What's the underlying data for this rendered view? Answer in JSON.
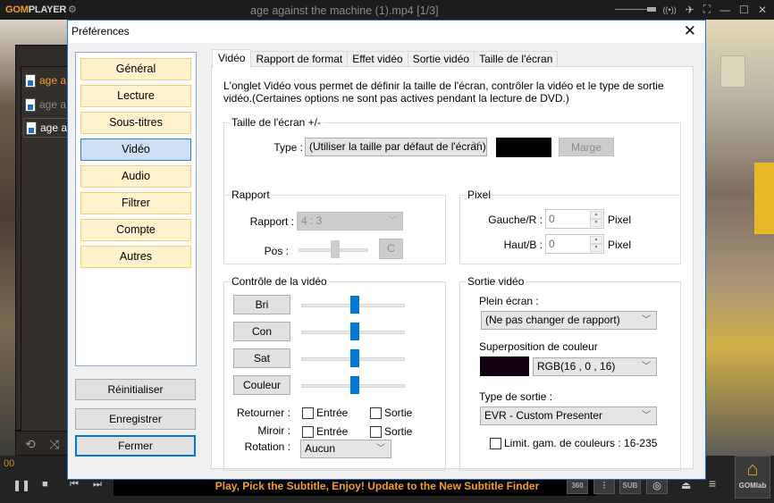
{
  "player": {
    "logo_gom": "GOM",
    "logo_player": "PLAYER",
    "title": "age against the machine (1).mp4  [1/3]",
    "playlist": [
      {
        "label": "age a",
        "state": "playing",
        "color": "#f0a020"
      },
      {
        "label": "age a",
        "state": "normal",
        "color": "#8a8a8a"
      },
      {
        "label": "age a",
        "state": "selected",
        "color": "#ffffff"
      }
    ],
    "timecode": "00",
    "ticker": "Play, Pick the Subtitle, Enjoy! Update to the New Subtitle Finder",
    "buttons": {
      "vr360": "360",
      "sub": "SUB",
      "gomlab": "GOMlab"
    },
    "icons": {
      "gear": "⚙",
      "broadcast": "((•))",
      "pin": "✈",
      "fullscreen": "⛶",
      "minimize": "—",
      "maximize": "☐",
      "close": "✕",
      "repeat": "⟲",
      "shuffle": "⤨",
      "pause": "❚❚",
      "stop": "■",
      "prev": "⏮",
      "next": "⏭",
      "eject": "⏏",
      "menu": "≡",
      "equalizer": "⫶",
      "camera": "◎",
      "home": "⌂"
    }
  },
  "dialog": {
    "title": "Préférences",
    "close_icon": "✕",
    "nav": [
      {
        "label": "Général",
        "active": false
      },
      {
        "label": "Lecture",
        "active": false
      },
      {
        "label": "Sous-titres",
        "active": false
      },
      {
        "label": "Vidéo",
        "active": true
      },
      {
        "label": "Audio",
        "active": false
      },
      {
        "label": "Filtrer",
        "active": false
      },
      {
        "label": "Compte",
        "active": false
      },
      {
        "label": "Autres",
        "active": false
      }
    ],
    "actions": {
      "reset": "Réinitialiser",
      "save": "Enregistrer",
      "close": "Fermer"
    },
    "tabs": [
      {
        "label": "Vidéo",
        "active": true
      },
      {
        "label": "Rapport de format",
        "active": false
      },
      {
        "label": "Effet vidéo",
        "active": false
      },
      {
        "label": "Sortie vidéo",
        "active": false
      },
      {
        "label": "Taille de l'écran",
        "active": false
      }
    ],
    "description": "L'onglet Vidéo vous permet de définir la taille de l'écran, contrôler la vidéo et le type de sortie vidéo.(Certaines options ne sont pas actives pendant la lecture de DVD.)",
    "screen_size": {
      "group_label": "Taille de l'écran +/-",
      "type_label": "Type :",
      "type_value": "(Utiliser la taille par défaut de l'écran)",
      "swatch_color": "#000000",
      "margin_button": "Marge"
    },
    "ratio": {
      "group_label": "Rapport",
      "ratio_label": "Rapport :",
      "ratio_value": "4 : 3",
      "pos_label": "Pos :",
      "pos_value": 0.5,
      "reset_button": "C"
    },
    "pixel": {
      "group_label": "Pixel",
      "left_label": "Gauche/R :",
      "left_value": "0",
      "top_label": "Haut/B :",
      "top_value": "0",
      "unit": "Pixel"
    },
    "video_control": {
      "group_label": "Contrôle de la vidéo",
      "sliders": [
        {
          "label": "Bri",
          "value": 0.5
        },
        {
          "label": "Con",
          "value": 0.5
        },
        {
          "label": "Sat",
          "value": 0.5
        },
        {
          "label": "Couleur",
          "value": 0.5
        }
      ],
      "flip_label": "Retourner :",
      "mirror_label": "Miroir :",
      "input_label": "Entrée",
      "output_label": "Sortie",
      "flip_input": false,
      "flip_output": false,
      "mirror_input": false,
      "mirror_output": false,
      "rotation_label": "Rotation :",
      "rotation_value": "Aucun"
    },
    "video_output": {
      "group_label": "Sortie vidéo",
      "fullscreen_label": "Plein écran :",
      "fullscreen_value": "(Ne pas changer de rapport)",
      "overlay_label": "Superposition de couleur",
      "overlay_swatch": "#100010",
      "overlay_value": "RGB(16 , 0 , 16)",
      "output_type_label": "Type de sortie :",
      "output_type_value": "EVR - Custom Presenter",
      "limit_range_label": "Limit. gam. de couleurs : 16-235",
      "limit_range_checked": false
    }
  }
}
